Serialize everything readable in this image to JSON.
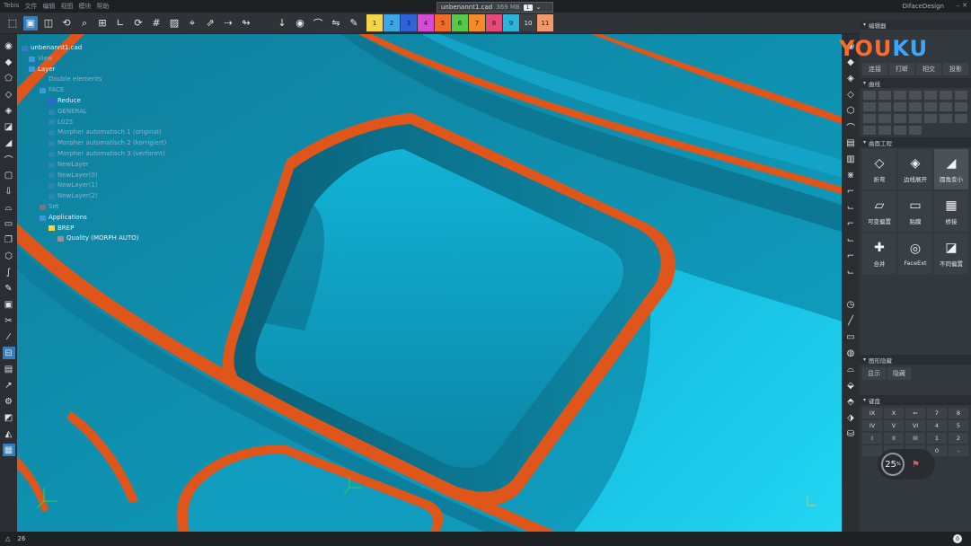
{
  "window": {
    "menu": [
      "Tebis",
      "文件",
      "编辑",
      "视图",
      "模块",
      "帮助"
    ],
    "doc_name": "unbenannt1.cad",
    "doc_size": "369 MB",
    "doc_index": "1",
    "brand": "DifaceDesign"
  },
  "toolbar": {
    "layers": [
      {
        "label": "1",
        "color": "#f3d44a"
      },
      {
        "label": "2",
        "color": "#3fa6e6"
      },
      {
        "label": "3",
        "color": "#2f63d6"
      },
      {
        "label": "4",
        "color": "#d64ad6"
      },
      {
        "label": "5",
        "color": "#f06a2a"
      },
      {
        "label": "6",
        "color": "#58c84a"
      },
      {
        "label": "7",
        "color": "#f58a2a"
      },
      {
        "label": "8",
        "color": "#e64a7a"
      },
      {
        "label": "9",
        "color": "#2ab5d8"
      },
      {
        "label": "10",
        "color": "#3a3f44"
      },
      {
        "label": "11",
        "color": "#f09a6a"
      }
    ]
  },
  "tree": {
    "root": "unbenannt1.cad",
    "view": "View",
    "layer": "Layer",
    "items": [
      "Double elements",
      "FACE",
      "Reduce",
      "GENERAL",
      "L025",
      "Morpher automatisch 1 (original)",
      "Morpher automatisch 2 (korrigiert)",
      "Morpher automatisch 3 (verformt)",
      "NewLayer",
      "NewLayer(0)",
      "NewLayer(1)",
      "NewLayer(2)"
    ],
    "set": "Set",
    "applications": "Applications",
    "brep": "BREP",
    "quality": "Quality (MORPH AUTO)"
  },
  "panel": {
    "editor_title": "编辑器",
    "editor_tabs": [
      "连接",
      "打断",
      "相交",
      "投影"
    ],
    "curves_title": "曲线",
    "surface_title": "曲面工程",
    "surface_tools": [
      {
        "label": "折弯",
        "icon": "◇"
      },
      {
        "label": "边线展开",
        "icon": "◈"
      },
      {
        "label": "圆角变小",
        "icon": "◢"
      },
      {
        "label": "可变偏置",
        "icon": "▱"
      },
      {
        "label": "贴膜",
        "icon": "▭"
      },
      {
        "label": "桥接",
        "icon": "▦"
      },
      {
        "label": "合并",
        "icon": "✚"
      },
      {
        "label": "FaceExt",
        "icon": "◎"
      },
      {
        "label": "不同偏置",
        "icon": "◪"
      }
    ],
    "display_title": "图形隐藏",
    "display_tabs": [
      "显示",
      "隐藏"
    ],
    "keypad_title": "键盘",
    "keypad": [
      "IX",
      "X",
      "⇐",
      "7",
      "8",
      "IV",
      "V",
      "VI",
      "4",
      "5",
      "I",
      "II",
      "III",
      "1",
      "2",
      "",
      "",
      "",
      "0",
      "-"
    ]
  },
  "dial": {
    "value": "25",
    "unit": "%"
  },
  "status": {
    "count": "26",
    "right": "0"
  },
  "watermark": {
    "part1": "YOU",
    "part2": "KU"
  }
}
